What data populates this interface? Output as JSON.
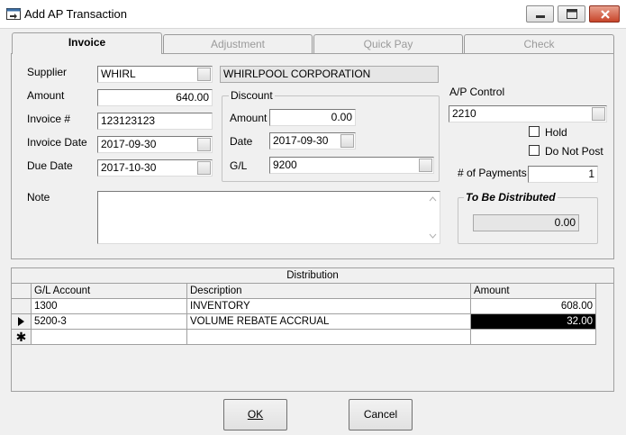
{
  "window": {
    "title": "Add AP Transaction"
  },
  "tabs": [
    {
      "label": "Invoice"
    },
    {
      "label": "Adjustment"
    },
    {
      "label": "Quick Pay"
    },
    {
      "label": "Check"
    }
  ],
  "invoice": {
    "supplier_label": "Supplier",
    "supplier_code": "WHIRL",
    "supplier_name": "WHIRLPOOL CORPORATION",
    "amount_label": "Amount",
    "amount": "640.00",
    "invoice_no_label": "Invoice #",
    "invoice_no": "123123123",
    "invoice_date_label": "Invoice Date",
    "invoice_date": "2017-09-30",
    "due_date_label": "Due Date",
    "due_date": "2017-10-30",
    "note_label": "Note",
    "note": "",
    "discount": {
      "title": "Discount",
      "amount_label": "Amount",
      "amount": "0.00",
      "date_label": "Date",
      "date": "2017-09-30",
      "gl_label": "G/L",
      "gl": "9200"
    },
    "ap_control_label": "A/P Control",
    "ap_control": "2210",
    "hold_label": "Hold",
    "hold_checked": false,
    "do_not_post_label": "Do Not Post",
    "do_not_post_checked": false,
    "num_payments_label": "# of Payments",
    "num_payments": "1",
    "to_be_distributed_label": "To Be Distributed",
    "to_be_distributed": "0.00"
  },
  "distribution": {
    "title": "Distribution",
    "columns": [
      "G/L Account",
      "Description",
      "Amount"
    ],
    "rows": [
      {
        "gl": "1300",
        "description": "INVENTORY",
        "amount": "608.00"
      },
      {
        "gl": "5200-3",
        "description": "VOLUME REBATE ACCRUAL",
        "amount": "32.00"
      },
      {
        "gl": "",
        "description": "",
        "amount": ""
      }
    ]
  },
  "buttons": {
    "ok": "OK",
    "cancel": "Cancel"
  },
  "colors": {
    "selected_cell_bg": "#000000",
    "selected_cell_fg": "#ffffff"
  }
}
